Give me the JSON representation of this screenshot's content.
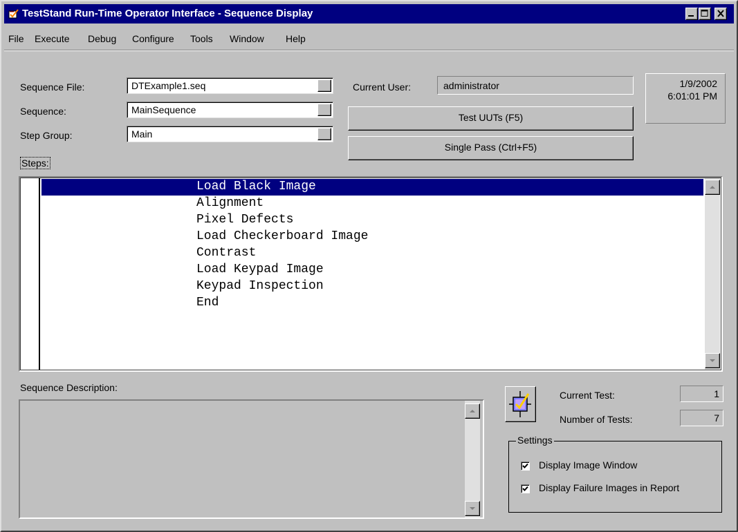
{
  "window": {
    "title": "TestStand Run-Time Operator Interface - Sequence Display"
  },
  "menu": [
    "File",
    "Execute",
    "Debug",
    "Configure",
    "Tools",
    "Window",
    "Help"
  ],
  "form": {
    "sequence_file_label": "Sequence File:",
    "sequence_file_value": "DTExample1.seq",
    "sequence_label": "Sequence:",
    "sequence_value": "MainSequence",
    "step_group_label": "Step Group:",
    "step_group_value": "Main",
    "current_user_label": "Current User:",
    "current_user_value": "administrator",
    "date": "1/9/2002",
    "time": "6:01:01 PM",
    "test_uuts_button": "Test UUTs (F5)",
    "single_pass_button": "Single Pass (Ctrl+F5)"
  },
  "steps": {
    "label": "Steps:",
    "selected_index": 0,
    "items": [
      "Load Black Image",
      "Alignment",
      "Pixel Defects",
      "Load Checkerboard Image",
      "Contrast",
      "Load Keypad Image",
      "Keypad Inspection",
      "End"
    ]
  },
  "description": {
    "label": "Sequence Description:",
    "text": ""
  },
  "status": {
    "current_test_label": "Current Test:",
    "current_test_value": "1",
    "number_of_tests_label": "Number of Tests:",
    "number_of_tests_value": "7"
  },
  "settings": {
    "title": "Settings",
    "display_image_window_label": "Display Image Window",
    "display_image_window_checked": true,
    "display_failure_images_label": "Display Failure Images in Report",
    "display_failure_images_checked": true
  },
  "colors": {
    "titlebar": "#000080",
    "face": "#c0c0c0",
    "selection": "#000080"
  },
  "icons": {
    "app": "teststand-app-icon",
    "minimize": "minimize-icon",
    "maximize": "maximize-icon",
    "close": "close-icon",
    "dropdown": "dropdown-arrow-icon",
    "scroll_up": "scroll-up-arrow-icon",
    "scroll_down": "scroll-down-arrow-icon",
    "test_run": "checklist-icon"
  }
}
